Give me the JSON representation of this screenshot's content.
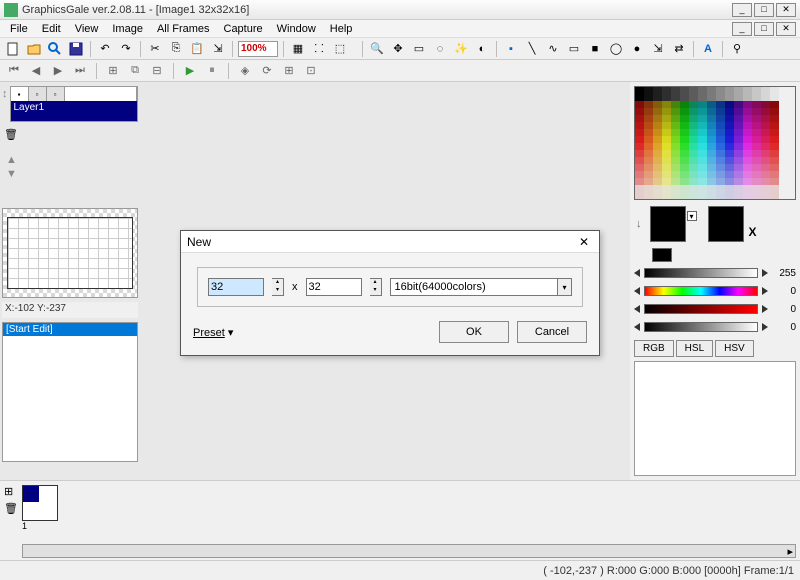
{
  "title": "GraphicsGale ver.2.08.11 - [Image1 32x32x16]",
  "menu": [
    "File",
    "Edit",
    "View",
    "Image",
    "All Frames",
    "Capture",
    "Window",
    "Help"
  ],
  "zoom": "100%",
  "layer": {
    "name": "Layer1"
  },
  "coords": "X:-102 Y:-237",
  "edit_header": "[Start Edit]",
  "dialog": {
    "title": "New",
    "width": "32",
    "height": "32",
    "x_label": "x",
    "colordepth": "16bit(64000colors)",
    "preset": "Preset",
    "ok": "OK",
    "cancel": "Cancel"
  },
  "sliders": {
    "gray_val": "255",
    "hue_val": "0",
    "red_val": "0",
    "black_val": "0"
  },
  "tabs": {
    "rgb": "RGB",
    "hsl": "HSL",
    "hsv": "HSV"
  },
  "status": "( -102,-237 ) R:000 G:000 B:000  [0000h]  Frame:1/1"
}
